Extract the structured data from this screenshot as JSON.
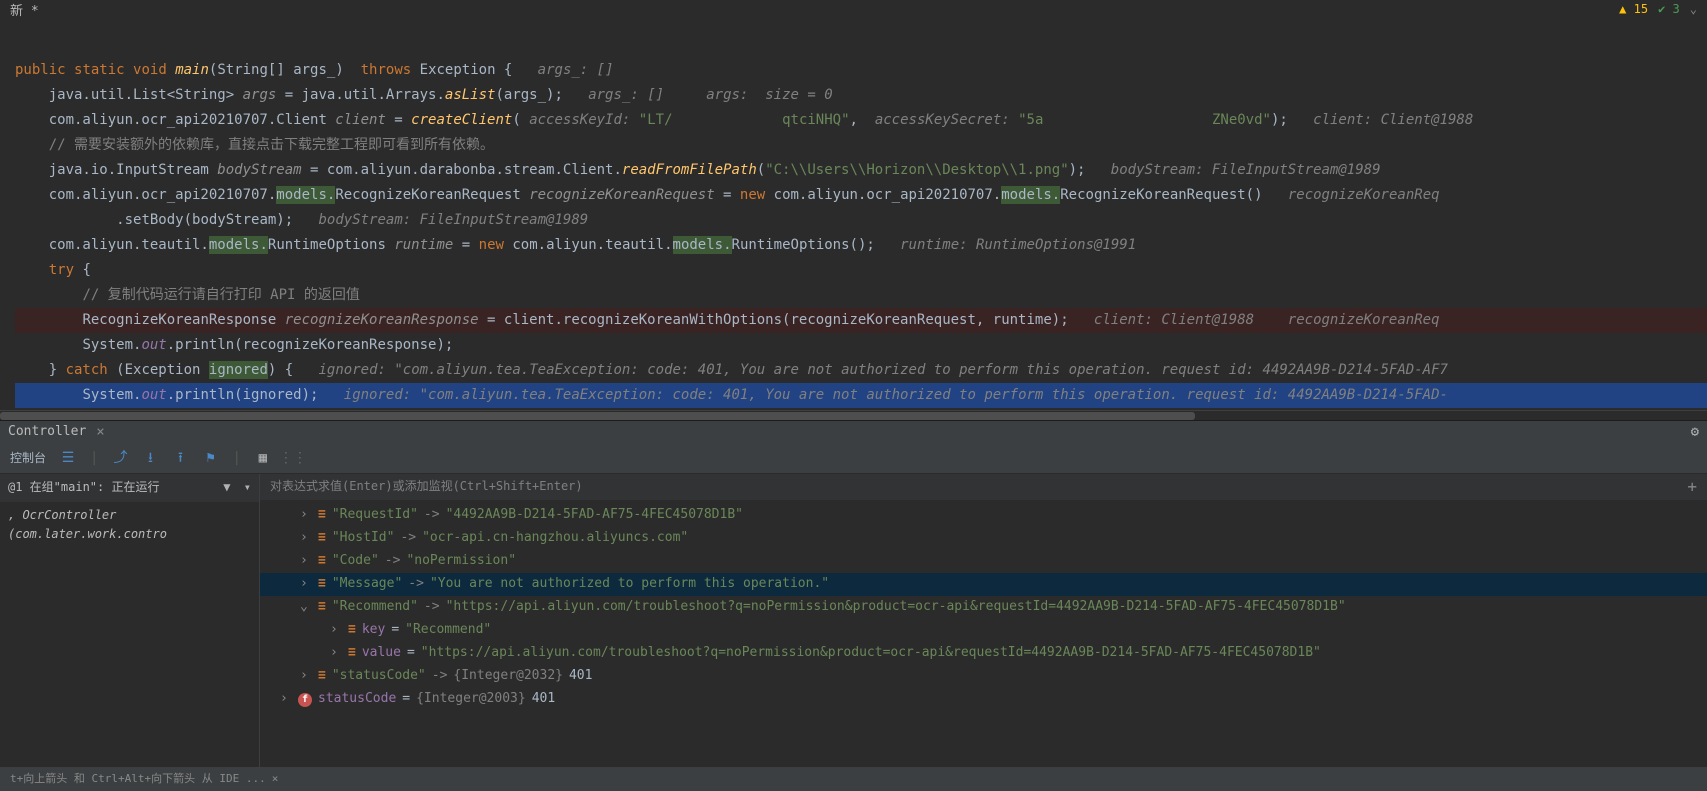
{
  "top": {
    "tab": "新 *",
    "warn": "15",
    "ok": "3"
  },
  "code": {
    "l1_kw1": "public",
    "l1_kw2": "static",
    "l1_kw3": "void",
    "l1_fn": "main",
    "l1_rest": "(String[] args_)",
    "l1_kw4": "throws",
    "l1_exc": "Exception {",
    "l1_hint": "args_: []",
    "l2_a": "java.util.List<String> ",
    "l2_var": "args",
    "l2_b": " = java.util.Arrays.",
    "l2_fn": "asList",
    "l2_c": "(args_);",
    "l2_hint1": "args_: []",
    "l2_hint2": "args:  size = 0",
    "l3_a": "com.aliyun.ocr_api20210707.Client ",
    "l3_var": "client",
    "l3_b": " = ",
    "l3_fn": "createClient",
    "l3_c": "(",
    "l3_p1": "accessKeyId:",
    "l3_s1": "\"LT/             qtciNHQ\"",
    "l3_d": ",",
    "l3_p2": "accessKeySecret:",
    "l3_s2": "\"5a                    ZNe0vd\"",
    "l3_e": ");",
    "l3_hint": "client: Client@1988",
    "l4": "// 需要安装额外的依赖库，直接点击下载完整工程即可看到所有依赖。",
    "l5_a": "java.io.InputStream ",
    "l5_var": "bodyStream",
    "l5_b": " = com.aliyun.darabonba.stream.Client.",
    "l5_fn": "readFromFilePath",
    "l5_c": "(",
    "l5_s": "\"C:\\\\Users\\\\Horizon\\\\Desktop\\\\1.png\"",
    "l5_d": ");",
    "l5_hint": "bodyStream: FileInputStream@1989",
    "l6_a": "com.aliyun.ocr_api20210707.",
    "l6_hl1": "models.",
    "l6_b": "RecognizeKoreanRequest ",
    "l6_var": "recognizeKoreanRequest",
    "l6_c": " = ",
    "l6_kw": "new",
    "l6_d": " com.aliyun.ocr_api20210707.",
    "l6_hl2": "models.",
    "l6_e": "RecognizeKoreanRequest()",
    "l6_hint": "recognizeKoreanReq",
    "l7_a": ".setBody(bodyStream);",
    "l7_hint": "bodyStream: FileInputStream@1989",
    "l8_a": "com.aliyun.teautil.",
    "l8_hl1": "models.",
    "l8_b": "RuntimeOptions ",
    "l8_var": "runtime",
    "l8_c": " = ",
    "l8_kw": "new",
    "l8_d": " com.aliyun.teautil.",
    "l8_hl2": "models.",
    "l8_e": "RuntimeOptions();",
    "l8_hint": "runtime: RuntimeOptions@1991",
    "l9_kw": "try",
    "l9_a": " {",
    "l10": "// 复制代码运行请自行打印 API 的返回值",
    "l11_a": "RecognizeKoreanResponse ",
    "l11_var": "recognizeKoreanResponse",
    "l11_b": " = client.recognizeKoreanWithOptions(recognizeKoreanRequest, runtime);",
    "l11_hint": "client: Client@1988    recognizeKoreanReq",
    "l12_a": "System.",
    "l12_f": "out",
    "l12_b": ".println(recognizeKoreanResponse);",
    "l13_a": "} ",
    "l13_kw": "catch",
    "l13_b": " (Exception ",
    "l13_hl": "ignored",
    "l13_c": ") {",
    "l13_hint": "ignored: \"com.aliyun.tea.TeaException: code: 401, You are not authorized to perform this operation. request id: 4492AA9B-D214-5FAD-AF7",
    "l14_a": "System.",
    "l14_f": "out",
    "l14_b": ".println(ignored);",
    "l14_hint": "ignored: \"com.aliyun.tea.TeaException: code: 401, You are not authorized to perform this operation. request id: 4492AA9B-D214-5FAD-",
    "l15": "}"
  },
  "panel": {
    "tab": "Controller",
    "toolbar_label": "控制台"
  },
  "left": {
    "head": "@1 在组\"main\": 正在运行",
    "row": ", OcrController (com.later.work.contro"
  },
  "watch": {
    "placeholder": "对表达式求值(Enter)或添加监视(Ctrl+Shift+Enter)"
  },
  "tree": {
    "r1_k": "\"RequestId\"",
    "r1_a": " -> ",
    "r1_v": "\"4492AA9B-D214-5FAD-AF75-4FEC45078D1B\"",
    "r2_k": "\"HostId\"",
    "r2_a": " -> ",
    "r2_v": "\"ocr-api.cn-hangzhou.aliyuncs.com\"",
    "r3_k": "\"Code\"",
    "r3_a": " -> ",
    "r3_v": "\"noPermission\"",
    "r4_k": "\"Message\"",
    "r4_a": " -> ",
    "r4_v": "\"You are not authorized to perform this operation.\"",
    "r5_k": "\"Recommend\"",
    "r5_a": " -> ",
    "r5_v": "\"https://api.aliyun.com/troubleshoot?q=noPermission&product=ocr-api&requestId=4492AA9B-D214-5FAD-AF75-4FEC45078D1B\"",
    "r6_k": "key",
    "r6_b": " = ",
    "r6_v": "\"Recommend\"",
    "r7_k": "value",
    "r7_b": " = ",
    "r7_v": "\"https://api.aliyun.com/troubleshoot?q=noPermission&product=ocr-api&requestId=4492AA9B-D214-5FAD-AF75-4FEC45078D1B\"",
    "r8_k": "\"statusCode\"",
    "r8_a": " -> ",
    "r8_g": "{Integer@2032} ",
    "r8_v": "401",
    "r9_k": "statusCode",
    "r9_b": " = ",
    "r9_g": "{Integer@2003} ",
    "r9_v": "401"
  },
  "status": {
    "text": "t+向上箭头 和 Ctrl+Alt+向下箭头 从 IDE ..."
  }
}
